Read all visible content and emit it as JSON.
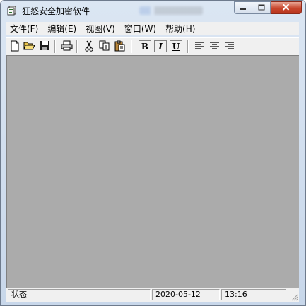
{
  "window": {
    "title": "狂怒安全加密软件"
  },
  "caption": {
    "minimize_icon": "minimize-icon",
    "maximize_icon": "maximize-icon",
    "close_icon": "close-icon"
  },
  "menu": {
    "items": [
      {
        "label": "文件(F)"
      },
      {
        "label": "编辑(E)"
      },
      {
        "label": "视图(V)"
      },
      {
        "label": "窗口(W)"
      },
      {
        "label": "帮助(H)"
      }
    ]
  },
  "toolbar": {
    "icons": [
      "new-file-icon",
      "open-folder-icon",
      "save-icon",
      "print-icon",
      "cut-icon",
      "copy-icon",
      "paste-icon"
    ],
    "bold_label": "B",
    "italic_label": "I",
    "underline_label": "U",
    "align_icons": [
      "align-left-icon",
      "align-center-icon",
      "align-right-icon"
    ]
  },
  "colors": {
    "client_background": "#ababab",
    "close_button": "#c7452c"
  },
  "status": {
    "text": "状态",
    "date": "2020-05-12",
    "time": "13:16"
  }
}
